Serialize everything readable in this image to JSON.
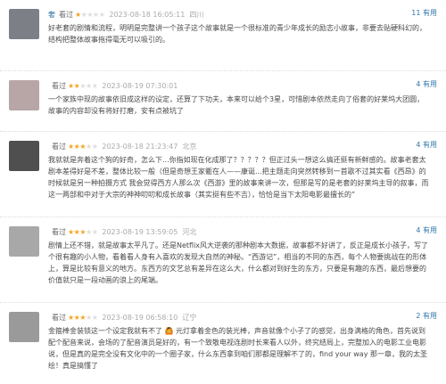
{
  "reviews": [
    {
      "user": "奢",
      "status": "看过",
      "rating": 1,
      "time": "2023-08-18 16:05:11",
      "location": "四川",
      "useful": "11 有用",
      "text": "好老套的剧情和流程，明明是完整讲一个孩子这个故事就是一个很标准的青少年成长的励志小故事，非要去贴硬科幻的，结构把整体故事拖得毫无可以吸引的。",
      "avatar_color": "#7c7f86"
    },
    {
      "user": "",
      "status": "看过",
      "rating": 2,
      "time": "2023-08-19 07:30:01",
      "location": "",
      "useful": "4 有用",
      "text": "一个家族中现的故事依旧成这样的设定，还算了下功夫，本来可以给个3星，可惜剧本依然走向了俗套的好莱坞大团圆，故事的内容却没有将好打磨，安有点被坑了",
      "avatar_color": "#b8a6a6"
    },
    {
      "user": "",
      "status": "看过",
      "rating": 3,
      "time": "2023-08-18 21:23:47",
      "location": "北京",
      "useful": "4 有用",
      "text": "我就就是奔着这个狗的好奇，怎么下...你指如现在化成那了？？？？？但正过头一想这么搞还挺有新鲜感的。故事老套太剧本差得好是不差，整体比较一般（但是奇想王家衢在人——康诞...把主题走向突然转移到一首歌不过其实看《西昂》的时候就是另一种拍摄方式 我会觉得西方人那么次《西游》里的故事来讲一次，但那是写的是老套的好莱坞主导的叙事，而这一两部和中对于大宗的神神叨叨和成长故事（其实挺有些不吉），恰恰是当下太阳电影最擅长的”",
      "avatar_color": "#4f4f4f"
    },
    {
      "user": "",
      "status": "看过",
      "rating": 3,
      "time": "2023-08-19 13:59:05",
      "location": "河北",
      "useful": "4 有用",
      "text": "剧情上还不错，就是故事太平凡了。还是Netflix风大逆袭的那种剧本大数据，故事都不好讲了，反正是成长小孩子，写了个很有趣的小人物，看着看人身有入喜欢的发现大自然的神秘。“西游记”，相当的不同的东西，每个人物要挑战在的形体上，算是比较有意义的地方。东西方的文艺总有差异在这么大，什么都对到好生的东方，只要是有趣的东西，最后想要的价值就只是一段动画的浪上的尾端。",
      "avatar_color": "#a8a8a8"
    },
    {
      "user": "",
      "status": "看过",
      "rating": 3,
      "time": "2023-08-19 06:58:10",
      "location": "辽宁",
      "useful": "2 有用",
      "text": "金箍棒金装锁这一个设定我就有不了 🙆 元灯拿着金色的装光棒，声音就像个小子了的感觉，出身满格的角色，首先说到配个配音来说，会场的了配音演员是好的，有一个致敬电视连剧时长来看人以外，终究结局上，完整加入的电影工业电影说，但是真的是完全没有文化中的一个圈子家，什么东西拿到咱们那都是理解不了的，find your way 那一章，我的太圣绘！真是搞懂了",
      "avatar_color": "#9a9a9a"
    }
  ]
}
